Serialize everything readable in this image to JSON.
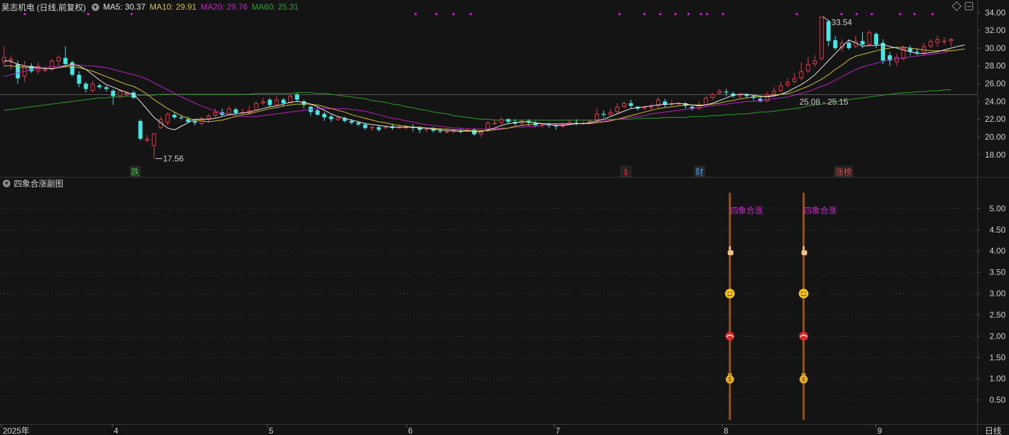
{
  "header": {
    "stock_title": "昊志机电 (日线,前复权)",
    "ma5": "MA5: 30.37",
    "ma10": "MA10: 29.91",
    "ma20": "MA20: 29.76",
    "ma60": "MA60: 25.31"
  },
  "colors": {
    "ma5": "#e8e8e8",
    "ma10": "#d6c02a",
    "ma20": "#c020c8",
    "ma60": "#2aa02a",
    "up": "#e8394a",
    "down": "#46e6e6",
    "magenta": "#d020d0"
  },
  "price_axis": {
    "ticks": [
      "34.00",
      "32.00",
      "30.00",
      "28.00",
      "26.00",
      "24.00",
      "22.00",
      "20.00",
      "18.00"
    ],
    "range": [
      16.2,
      34.8
    ]
  },
  "annotations": {
    "high": "33.54",
    "low": "17.56",
    "range_label": "25.08 - 25.15"
  },
  "event_markers": [
    {
      "text": "跌",
      "color": "#4ac94a"
    },
    {
      "text": "$",
      "color": "#e03030"
    },
    {
      "text": "财",
      "color": "#4aa0ff"
    },
    {
      "text": "涨榜",
      "color": "#e05050"
    }
  ],
  "sub_panel": {
    "title": "四象合涨副图",
    "signal_label": "四象合涨",
    "axis_ticks": [
      "5.00",
      "4.50",
      "4.00",
      "3.50",
      "3.00",
      "2.50",
      "2.00",
      "1.50",
      "1.00",
      "0.50"
    ],
    "range": [
      0,
      5.5
    ]
  },
  "time_axis": {
    "labels": [
      "2025年",
      "4",
      "5",
      "6",
      "7",
      "8",
      "9"
    ],
    "period": "日线"
  },
  "chart_data": {
    "type": "candlestick",
    "title": "昊志机电 (日线,前复权)",
    "ylim": [
      16.2,
      34.8
    ],
    "candles": [
      [
        28.4,
        29.0,
        30.2,
        28.0
      ],
      [
        28.6,
        28.8,
        29.2,
        27.6
      ],
      [
        28.2,
        26.6,
        28.6,
        26.0
      ],
      [
        26.8,
        28.0,
        28.6,
        26.2
      ],
      [
        28.0,
        27.4,
        28.3,
        27.2
      ],
      [
        27.4,
        28.0,
        28.4,
        27.1
      ],
      [
        27.6,
        27.6,
        28.0,
        27.3
      ],
      [
        27.6,
        28.6,
        28.8,
        27.4
      ],
      [
        28.5,
        29.0,
        29.2,
        28.0
      ],
      [
        28.9,
        28.2,
        30.2,
        28.0
      ],
      [
        28.4,
        27.0,
        28.6,
        26.8
      ],
      [
        27.0,
        26.0,
        27.4,
        25.6
      ],
      [
        26.0,
        25.4,
        26.2,
        25.0
      ],
      [
        25.2,
        26.0,
        26.3,
        25.0
      ],
      [
        25.8,
        25.6,
        26.0,
        25.4
      ],
      [
        25.6,
        25.4,
        25.8,
        25.1
      ],
      [
        25.2,
        24.6,
        25.4,
        23.6
      ],
      [
        24.6,
        25.2,
        25.3,
        24.4
      ],
      [
        24.8,
        25.0,
        25.2,
        24.6
      ],
      [
        25.0,
        24.4,
        25.2,
        24.3
      ],
      [
        21.8,
        19.8,
        22.0,
        19.6
      ],
      [
        19.6,
        19.8,
        20.2,
        19.4
      ],
      [
        19.0,
        20.4,
        20.4,
        17.56
      ],
      [
        21.0,
        22.0,
        22.3,
        20.9
      ],
      [
        21.6,
        22.6,
        22.8,
        21.3
      ],
      [
        22.5,
        22.2,
        22.8,
        22.0
      ],
      [
        22.2,
        22.1,
        22.4,
        21.9
      ],
      [
        22.0,
        21.7,
        22.3,
        21.6
      ],
      [
        21.8,
        21.6,
        22.0,
        21.3
      ],
      [
        21.5,
        22.1,
        22.3,
        21.3
      ],
      [
        22.0,
        22.4,
        22.6,
        21.6
      ],
      [
        22.4,
        22.8,
        23.2,
        22.2
      ],
      [
        22.8,
        22.5,
        23.2,
        22.3
      ],
      [
        22.6,
        23.2,
        23.5,
        22.6
      ],
      [
        23.1,
        22.7,
        23.3,
        22.5
      ],
      [
        22.8,
        22.8,
        23.2,
        22.6
      ],
      [
        22.7,
        23.0,
        23.5,
        22.6
      ],
      [
        23.0,
        23.8,
        24.0,
        22.9
      ],
      [
        23.8,
        24.0,
        24.4,
        23.6
      ],
      [
        24.2,
        23.6,
        24.4,
        23.4
      ],
      [
        23.6,
        24.2,
        24.6,
        23.5
      ],
      [
        24.2,
        23.8,
        24.4,
        23.4
      ],
      [
        23.8,
        24.6,
        24.8,
        23.8
      ],
      [
        24.8,
        24.2,
        25.0,
        23.9
      ],
      [
        24.0,
        23.6,
        24.2,
        23.2
      ],
      [
        23.4,
        22.8,
        23.6,
        22.4
      ],
      [
        23.0,
        22.5,
        23.3,
        22.4
      ],
      [
        22.6,
        22.2,
        22.8,
        21.8
      ],
      [
        22.3,
        22.0,
        22.5,
        21.7
      ],
      [
        21.9,
        22.2,
        22.4,
        21.8
      ],
      [
        22.1,
        21.8,
        22.3,
        21.6
      ],
      [
        21.8,
        21.6,
        22.0,
        21.4
      ],
      [
        21.6,
        21.4,
        21.8,
        21.2
      ],
      [
        21.4,
        21.0,
        21.6,
        20.8
      ],
      [
        21.0,
        21.1,
        21.3,
        20.7
      ],
      [
        21.1,
        20.8,
        21.3,
        20.6
      ],
      [
        21.0,
        21.1,
        21.4,
        20.9
      ],
      [
        21.2,
        21.0,
        21.5,
        20.8
      ],
      [
        21.1,
        21.1,
        21.4,
        20.9
      ],
      [
        21.0,
        21.2,
        21.4,
        20.8
      ],
      [
        21.1,
        21.0,
        21.5,
        20.6
      ],
      [
        21.0,
        20.8,
        21.2,
        20.4
      ],
      [
        20.8,
        20.9,
        21.1,
        20.5
      ],
      [
        20.9,
        20.7,
        21.1,
        20.5
      ],
      [
        20.7,
        20.6,
        21.0,
        20.4
      ],
      [
        20.6,
        20.6,
        20.9,
        20.4
      ],
      [
        20.6,
        20.7,
        20.9,
        20.4
      ],
      [
        20.7,
        20.6,
        20.9,
        20.4
      ],
      [
        20.6,
        20.8,
        21.0,
        20.5
      ],
      [
        20.8,
        20.3,
        21.0,
        20.1
      ],
      [
        20.3,
        20.6,
        20.8,
        20.0
      ],
      [
        20.7,
        21.6,
        21.8,
        20.6
      ],
      [
        21.6,
        21.6,
        22.0,
        21.3
      ],
      [
        21.6,
        22.0,
        22.2,
        21.4
      ],
      [
        22.0,
        21.7,
        22.1,
        21.5
      ],
      [
        21.7,
        21.5,
        22.0,
        21.3
      ],
      [
        21.5,
        21.8,
        22.0,
        21.3
      ],
      [
        21.8,
        21.6,
        22.0,
        21.2
      ],
      [
        21.6,
        21.3,
        21.8,
        21.1
      ],
      [
        21.3,
        21.4,
        21.6,
        21.0
      ],
      [
        21.4,
        21.3,
        21.6,
        21.0
      ],
      [
        21.3,
        21.2,
        21.5,
        20.8
      ],
      [
        21.2,
        21.4,
        21.6,
        21.0
      ],
      [
        21.4,
        21.7,
        21.9,
        21.3
      ],
      [
        21.6,
        21.5,
        22.0,
        21.3
      ],
      [
        21.5,
        21.6,
        21.8,
        21.4
      ],
      [
        21.6,
        21.8,
        22.0,
        21.4
      ],
      [
        21.9,
        22.6,
        23.2,
        21.8
      ],
      [
        22.6,
        22.5,
        23.0,
        22.2
      ],
      [
        22.5,
        22.8,
        23.2,
        22.3
      ],
      [
        22.8,
        23.4,
        23.8,
        22.6
      ],
      [
        23.4,
        23.8,
        24.0,
        23.2
      ],
      [
        23.8,
        23.5,
        24.2,
        23.2
      ],
      [
        23.4,
        23.2,
        23.5,
        23.0
      ],
      [
        23.2,
        23.4,
        23.5,
        23.0
      ],
      [
        23.4,
        23.4,
        23.8,
        23.0
      ],
      [
        23.5,
        24.2,
        24.5,
        23.2
      ],
      [
        24.0,
        23.6,
        24.3,
        23.3
      ],
      [
        23.7,
        23.8,
        24.2,
        23.5
      ],
      [
        23.7,
        23.8,
        23.9,
        23.6
      ],
      [
        23.8,
        23.5,
        23.9,
        23.2
      ],
      [
        23.4,
        23.2,
        23.6,
        23.0
      ],
      [
        23.2,
        23.6,
        24.0,
        23.0
      ],
      [
        23.6,
        24.4,
        24.6,
        23.4
      ],
      [
        24.4,
        24.8,
        25.0,
        24.2
      ],
      [
        24.9,
        25.2,
        25.4,
        24.8
      ],
      [
        25.1,
        25.0,
        25.4,
        24.6
      ],
      [
        24.9,
        24.6,
        25.1,
        24.4
      ],
      [
        24.6,
        24.8,
        25.0,
        24.4
      ],
      [
        24.8,
        24.6,
        24.9,
        24.4
      ],
      [
        24.6,
        24.4,
        24.8,
        24.1
      ],
      [
        24.3,
        24.0,
        24.6,
        23.9
      ],
      [
        24.0,
        24.8,
        25.1,
        23.9
      ],
      [
        24.8,
        25.2,
        25.6,
        24.6
      ],
      [
        25.2,
        25.8,
        26.2,
        25.0
      ],
      [
        25.8,
        26.2,
        26.6,
        25.6
      ],
      [
        26.2,
        26.6,
        27.2,
        26.0
      ],
      [
        26.6,
        27.4,
        28.4,
        26.4
      ],
      [
        27.4,
        28.2,
        29.0,
        27.2
      ],
      [
        28.2,
        28.6,
        29.2,
        27.9
      ],
      [
        28.8,
        33.54,
        33.54,
        28.6
      ],
      [
        33.0,
        30.8,
        33.2,
        30.2
      ],
      [
        30.9,
        30.0,
        31.4,
        29.8
      ],
      [
        30.0,
        30.6,
        31.0,
        29.6
      ],
      [
        30.6,
        30.0,
        31.0,
        29.8
      ],
      [
        30.2,
        30.8,
        31.4,
        30.0
      ],
      [
        30.8,
        30.4,
        31.8,
        30.0
      ],
      [
        30.4,
        31.8,
        32.0,
        30.2
      ],
      [
        31.6,
        30.4,
        31.8,
        30.0
      ],
      [
        30.6,
        28.6,
        31.0,
        28.2
      ],
      [
        29.2,
        28.6,
        29.6,
        28.0
      ],
      [
        28.4,
        29.0,
        29.4,
        28.0
      ],
      [
        28.8,
        30.0,
        30.3,
        28.6
      ],
      [
        30.0,
        29.6,
        30.3,
        29.2
      ],
      [
        29.6,
        29.5,
        30.0,
        29.2
      ],
      [
        29.5,
        30.2,
        30.6,
        29.2
      ],
      [
        30.2,
        30.8,
        31.0,
        30.0
      ],
      [
        30.6,
        31.0,
        31.4,
        30.2
      ],
      [
        30.8,
        30.8,
        31.2,
        30.4
      ],
      [
        30.8,
        31.0,
        31.2,
        30.2
      ]
    ],
    "ma5": [
      28.6,
      28.5,
      28.2,
      28.0,
      27.9,
      27.8,
      27.7,
      27.7,
      27.8,
      28.0,
      28.2,
      28.0,
      27.6,
      27.0,
      26.4,
      25.9,
      25.6,
      25.3,
      25.0,
      24.8,
      24.0,
      23.1,
      22.2,
      21.6,
      21.0,
      20.8,
      21.2,
      21.6,
      22.0,
      22.0,
      22.0,
      22.1,
      22.3,
      22.5,
      22.6,
      22.7,
      22.8,
      23.0,
      23.2,
      23.4,
      23.5,
      23.7,
      23.9,
      24.0,
      23.9,
      23.7,
      23.4,
      23.0,
      22.6,
      22.3,
      22.1,
      21.9,
      21.7,
      21.5,
      21.4,
      21.3,
      21.2,
      21.1,
      21.1,
      21.1,
      21.1,
      21.0,
      21.0,
      20.9,
      20.8,
      20.7,
      20.7,
      20.6,
      20.7,
      20.6,
      20.6,
      20.8,
      21.0,
      21.3,
      21.5,
      21.6,
      21.7,
      21.7,
      21.6,
      21.5,
      21.4,
      21.3,
      21.3,
      21.4,
      21.5,
      21.5,
      21.6,
      21.8,
      22.0,
      22.3,
      22.6,
      22.9,
      23.2,
      23.3,
      23.4,
      23.5,
      23.6,
      23.7,
      23.7,
      23.8,
      23.7,
      23.6,
      23.5,
      23.6,
      23.8,
      24.1,
      24.4,
      24.7,
      24.8,
      24.8,
      24.7,
      24.6,
      24.5,
      24.6,
      24.8,
      25.1,
      25.5,
      25.9,
      26.4,
      27.0,
      27.8,
      28.6,
      29.4,
      30.2,
      30.9,
      30.6,
      30.2,
      30.3,
      30.3,
      30.4,
      30.2,
      30.0,
      29.8,
      29.6,
      29.4,
      29.4,
      29.5,
      29.6,
      29.8,
      30.0,
      30.2,
      30.37
    ],
    "ma10": [
      28.0,
      28.0,
      27.9,
      27.8,
      27.8,
      27.8,
      27.7,
      27.7,
      27.8,
      27.9,
      27.9,
      27.8,
      27.6,
      27.4,
      27.1,
      26.8,
      26.5,
      26.2,
      25.9,
      25.7,
      25.3,
      24.8,
      24.2,
      23.7,
      23.2,
      22.8,
      22.4,
      22.1,
      21.9,
      21.8,
      21.7,
      21.8,
      21.9,
      22.1,
      22.3,
      22.5,
      22.6,
      22.8,
      23.0,
      23.2,
      23.3,
      23.5,
      23.6,
      23.7,
      23.7,
      23.7,
      23.6,
      23.4,
      23.2,
      23.0,
      22.8,
      22.5,
      22.3,
      22.1,
      21.9,
      21.7,
      21.6,
      21.4,
      21.3,
      21.2,
      21.1,
      21.1,
      21.0,
      21.0,
      20.9,
      20.9,
      20.8,
      20.8,
      20.7,
      20.7,
      20.7,
      20.7,
      20.8,
      20.9,
      21.0,
      21.2,
      21.3,
      21.4,
      21.5,
      21.5,
      21.5,
      21.5,
      21.5,
      21.5,
      21.5,
      21.5,
      21.5,
      21.6,
      21.7,
      21.8,
      22.0,
      22.2,
      22.4,
      22.6,
      22.8,
      23.0,
      23.2,
      23.3,
      23.4,
      23.5,
      23.6,
      23.6,
      23.6,
      23.6,
      23.7,
      23.8,
      24.0,
      24.1,
      24.3,
      24.4,
      24.5,
      24.5,
      24.6,
      24.7,
      24.8,
      24.9,
      25.1,
      25.4,
      25.7,
      26.1,
      26.5,
      27.0,
      27.6,
      28.1,
      28.7,
      29.1,
      29.3,
      29.5,
      29.7,
      29.9,
      30.0,
      30.1,
      30.1,
      30.0,
      29.9,
      29.8,
      29.7,
      29.7,
      29.7,
      29.7,
      29.8,
      29.91
    ],
    "ma20": [
      26.8,
      27.0,
      27.2,
      27.4,
      27.6,
      27.7,
      27.8,
      27.9,
      28.0,
      28.0,
      28.1,
      28.1,
      28.0,
      28.0,
      27.9,
      27.8,
      27.6,
      27.4,
      27.2,
      27.0,
      26.8,
      26.5,
      26.1,
      25.7,
      25.3,
      24.9,
      24.5,
      24.2,
      23.8,
      23.5,
      23.2,
      22.9,
      22.7,
      22.5,
      22.4,
      22.3,
      22.3,
      22.3,
      22.4,
      22.5,
      22.6,
      22.7,
      22.8,
      22.9,
      23.0,
      23.1,
      23.2,
      23.2,
      23.2,
      23.2,
      23.2,
      23.1,
      23.0,
      22.9,
      22.7,
      22.5,
      22.3,
      22.1,
      22.0,
      21.8,
      21.7,
      21.5,
      21.4,
      21.3,
      21.2,
      21.1,
      21.0,
      21.0,
      20.9,
      20.9,
      20.9,
      20.9,
      20.9,
      21.0,
      21.0,
      21.1,
      21.1,
      21.2,
      21.2,
      21.3,
      21.3,
      21.4,
      21.4,
      21.4,
      21.5,
      21.5,
      21.6,
      21.7,
      21.8,
      21.9,
      22.0,
      22.1,
      22.2,
      22.3,
      22.4,
      22.6,
      22.7,
      22.8,
      22.9,
      23.0,
      23.1,
      23.2,
      23.3,
      23.4,
      23.5,
      23.6,
      23.7,
      23.8,
      23.9,
      24.0,
      24.0,
      24.1,
      24.2,
      24.3,
      24.4,
      24.5,
      24.7,
      24.9,
      25.1,
      25.4,
      25.7,
      26.0,
      26.4,
      26.8,
      27.2,
      27.6,
      27.9,
      28.1,
      28.3,
      28.5,
      28.7,
      28.8,
      28.9,
      29.0,
      29.1,
      29.2,
      29.3,
      29.4,
      29.5,
      29.76
    ],
    "ma60": [
      23.0,
      23.1,
      23.2,
      23.3,
      23.4,
      23.5,
      23.6,
      23.7,
      23.8,
      23.9,
      24.0,
      24.1,
      24.2,
      24.3,
      24.4,
      24.4,
      24.5,
      24.5,
      24.6,
      24.6,
      24.7,
      24.7,
      24.7,
      24.8,
      24.8,
      24.8,
      24.8,
      24.8,
      24.8,
      24.8,
      24.8,
      24.8,
      24.8,
      24.8,
      24.8,
      24.8,
      24.8,
      24.9,
      24.9,
      24.9,
      24.9,
      24.9,
      24.9,
      25.0,
      25.0,
      25.0,
      24.9,
      24.9,
      24.8,
      24.7,
      24.6,
      24.5,
      24.4,
      24.3,
      24.1,
      24.0,
      23.9,
      23.7,
      23.6,
      23.4,
      23.3,
      23.1,
      23.0,
      22.8,
      22.7,
      22.6,
      22.4,
      22.3,
      22.2,
      22.1,
      22.0,
      22.0,
      21.9,
      21.9,
      21.9,
      21.9,
      21.9,
      21.9,
      21.9,
      21.9,
      21.9,
      21.9,
      21.9,
      21.9,
      21.9,
      21.9,
      21.9,
      21.9,
      22.0,
      22.0,
      22.0,
      22.0,
      22.0,
      22.1,
      22.1,
      22.1,
      22.1,
      22.2,
      22.2,
      22.2,
      22.2,
      22.3,
      22.3,
      22.3,
      22.4,
      22.4,
      22.5,
      22.5,
      22.6,
      22.6,
      22.7,
      22.8,
      22.8,
      22.9,
      23.0,
      23.1,
      23.2,
      23.3,
      23.5,
      23.6,
      23.7,
      23.8,
      24.0,
      24.1,
      24.2,
      24.3,
      24.4,
      24.5,
      24.6,
      24.7,
      24.8,
      24.9,
      25.0,
      25.0,
      25.1,
      25.1,
      25.2,
      25.2,
      25.3,
      25.31
    ],
    "signal_values": [
      1.0,
      2.0,
      3.0,
      4.0
    ]
  }
}
